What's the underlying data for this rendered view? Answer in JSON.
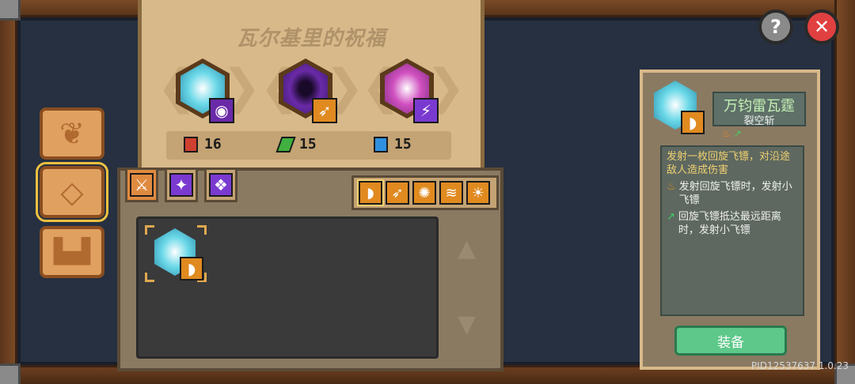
{
  "scroll": {
    "title": "瓦尔基里的祝福"
  },
  "stats": [
    {
      "icon": "red-gem-icon",
      "value": "16",
      "color": "#d04030"
    },
    {
      "icon": "green-leaf-icon",
      "value": "15",
      "color": "#40b040"
    },
    {
      "icon": "blue-book-icon",
      "value": "15",
      "color": "#3090e0"
    }
  ],
  "detail": {
    "title": "万钧雷瓦霆",
    "subtitle": "裂空斩",
    "main_desc": "发射一枚回旋飞镖，对沿途敌人造成伤害",
    "lines": [
      {
        "icon": "fire-icon",
        "text": "发射回旋飞镖时，发射小飞镖"
      },
      {
        "icon": "arrow-up-right-icon",
        "text": "回旋飞镖抵达最远距离时，发射小飞镖"
      }
    ],
    "equip_label": "装备"
  },
  "version": "PID12537637 1.0.23",
  "colors": {
    "cyan": "#6ad8e8",
    "purple": "#6a2aa8",
    "magenta": "#d050c0",
    "orange": "#e08a20"
  }
}
